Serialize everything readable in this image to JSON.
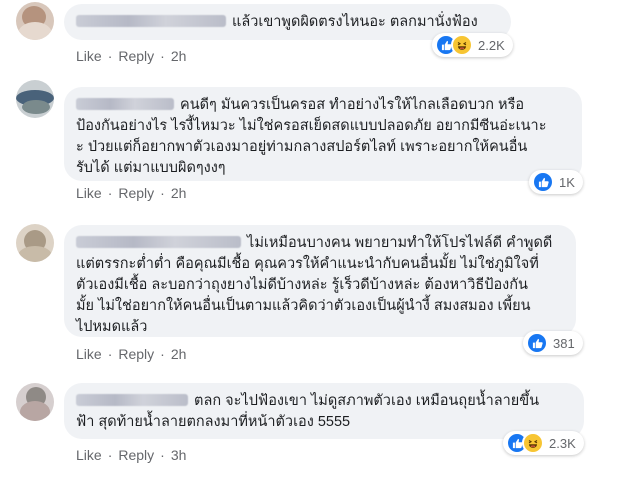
{
  "comments": [
    {
      "text": "แล้วเขาพูดผิดตรงไหนอะ ตลกมานั่งฟ้อง",
      "actions": {
        "like": "Like",
        "reply": "Reply",
        "time": "2h"
      },
      "reactions": {
        "icons": [
          "like-icon",
          "haha-icon"
        ],
        "count": "2.2K"
      }
    },
    {
      "text": "คนดีๆ มันควรเป็นครอส ทำอย่างไรให้ไกลเลือดบวก หรือ\nป้องกันอย่างไร ไรงี้ไหมวะ ไม่ใช่ครอสเย็ดสดแบบปลอดภัย อยากมีซีนอ่ะเนาะ\nะ ป่วยแต่ก็อยากพาตัวเองมาอยู่ท่ามกลางสปอร์ตไลท์ เพราะอยากให้คนอื่น\nรับได้ แต่มาแบบผิดๆงงๆ",
      "actions": {
        "like": "Like",
        "reply": "Reply",
        "time": "2h"
      },
      "reactions": {
        "icons": [
          "like-icon"
        ],
        "count": "1K"
      }
    },
    {
      "text": "ไม่เหมือนบางคน พยายามทำให้โปรไฟล์ดี คำพูดดี\nแต่ตรรกะต่ำต่ำ คือคุณมีเชื้อ คุณควรให้คำแนะนำกับคนอื่นมั้ย ไม่ใช่ภูมิใจที่\nตัวเองมีเชื้อ ละบอกว่าถุงยางไม่ดีบ้างหล่ะ รู้เร็วดีบ้างหล่ะ ต้องหาวิธีป้องกัน\nมั้ย ไม่ใช่อยากให้คนอื่นเป็นตามแล้วคิดว่าตัวเองเป็นผู้นำงี้ สมงสมอง เพี้ยน\nไปหมดแล้ว",
      "actions": {
        "like": "Like",
        "reply": "Reply",
        "time": "2h"
      },
      "reactions": {
        "icons": [
          "like-icon"
        ],
        "count": "381"
      }
    },
    {
      "text": "ตลก จะไปฟ้องเขา ไม่ดูสภาพตัวเอง เหมือนถุยน้ำลายขึ้น\nฟ้า สุดท้ายน้ำลายตกลงมาที่หน้าตัวเอง 5555",
      "actions": {
        "like": "Like",
        "reply": "Reply",
        "time": "3h"
      },
      "reactions": {
        "icons": [
          "like-icon",
          "haha-icon"
        ],
        "count": "2.3K"
      }
    }
  ],
  "colors": {
    "bubble": "#f0f2f5",
    "text": "#1c1e21",
    "meta": "#65676b",
    "like": "#1877f2",
    "haha": "#f7c533"
  }
}
